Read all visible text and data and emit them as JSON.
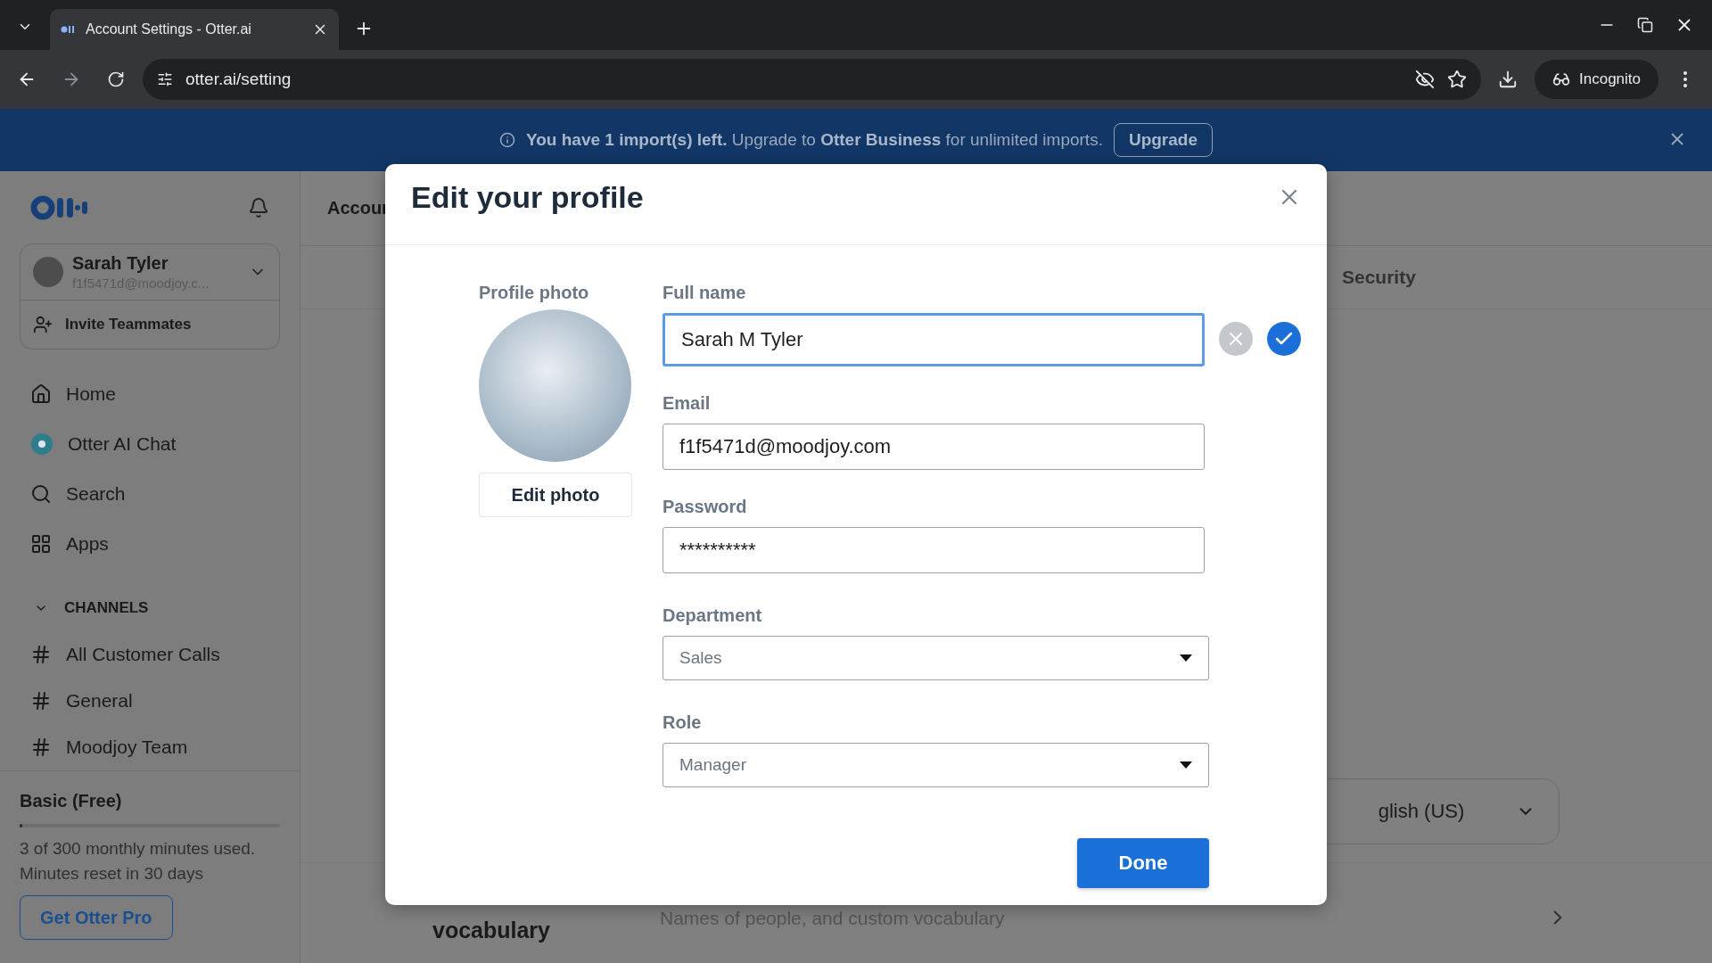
{
  "browser": {
    "tab_title": "Account Settings - Otter.ai",
    "url": "otter.ai/setting",
    "profile_label": "Incognito"
  },
  "banner": {
    "message": "**You have 1 import(s) left.** Upgrade to **Otter Business** for unlimited imports.",
    "button": "Upgrade"
  },
  "sidebar": {
    "user": {
      "name": "Sarah Tyler",
      "email": "f1f5471d@moodjoy.c..."
    },
    "invite": "Invite Teammates",
    "nav": [
      {
        "label": "Home",
        "kind": "home"
      },
      {
        "label": "Otter AI Chat",
        "kind": "chat"
      },
      {
        "label": "Search",
        "kind": "search"
      },
      {
        "label": "Apps",
        "kind": "apps"
      }
    ],
    "channels": {
      "title": "CHANNELS",
      "expanded": true,
      "items": [
        "All Customer Calls",
        "General",
        "Moodjoy Team"
      ]
    },
    "plan": {
      "name": "Basic (Free)",
      "level": 0.01,
      "usage": "3 of 300 monthly minutes used.",
      "reset": "Minutes reset in 30 days",
      "button": "Get Otter Pro"
    }
  },
  "page": {
    "heading": "Accour",
    "tab": "Security",
    "language": "glish (US)",
    "vocabulary_label": "vocabulary",
    "vocabulary_description": "Names of people, and custom vocabulary"
  },
  "modal": {
    "title": "Edit your profile",
    "photo_label": "Profile photo",
    "edit_photo": "Edit photo",
    "fields": [
      {
        "label": "Full name",
        "kind": "text",
        "value": "Sarah M Tyler",
        "focused": true
      },
      {
        "label": "Email",
        "kind": "text",
        "value": "f1f5471d@moodjoy.com",
        "focused": false
      },
      {
        "label": "Password",
        "kind": "password",
        "value": "**********",
        "focused": false
      },
      {
        "label": "Department",
        "kind": "select",
        "value": "Sales",
        "focused": false
      },
      {
        "label": "Role",
        "kind": "select",
        "value": "Manager",
        "focused": false
      }
    ],
    "done": "Done"
  }
}
